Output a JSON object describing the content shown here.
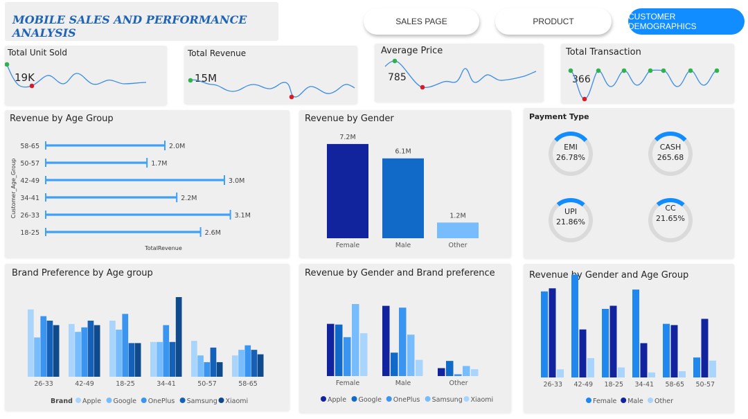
{
  "header": {
    "title": "MOBILE SALES AND PERFORMANCE ANALYSIS",
    "nav": [
      {
        "label": "SALES PAGE",
        "active": false
      },
      {
        "label": "PRODUCT",
        "active": false
      },
      {
        "label": "CUSTOMER DEMOGRAPHICS",
        "active": true
      }
    ]
  },
  "kpis": [
    {
      "title": "Total Unit Sold",
      "value": "19K"
    },
    {
      "title": "Total Revenue",
      "value": "15M"
    },
    {
      "title": "Average Price",
      "value": "785"
    },
    {
      "title": "Total Transaction",
      "value": "366"
    }
  ],
  "colors": {
    "accent": "#118dff",
    "line": "#3a8be6",
    "marker_high": "#2fb24c",
    "marker_low": "#d71c28",
    "navy": "#12239e",
    "mid_blue": "#1169c8",
    "light_blue": "#77bdfd"
  },
  "payment": {
    "title": "Payment Type",
    "items": [
      {
        "name": "EMI",
        "value": "26.78%",
        "fraction": 0.27
      },
      {
        "name": "CASH",
        "value": "265.68",
        "fraction": 0.26
      },
      {
        "name": "UPI",
        "value": "21.86%",
        "fraction": 0.22
      },
      {
        "name": "CC",
        "value": "21.65%",
        "fraction": 0.22
      }
    ]
  },
  "chart_data": [
    {
      "type": "bar",
      "orientation": "horizontal",
      "title": "Revenue by Age Group",
      "ylabel": "Customer_Age_Group",
      "xlabel": "TotalRevenue",
      "categories": [
        "58-65",
        "50-57",
        "42-49",
        "34-41",
        "26-33",
        "18-25"
      ],
      "values": [
        2.0,
        1.7,
        3.0,
        2.2,
        3.1,
        2.6
      ],
      "labels": [
        "2.0M",
        "1.7M",
        "3.0M",
        "2.2M",
        "3.1M",
        "2.6M"
      ]
    },
    {
      "type": "bar",
      "title": "Revenue by Gender",
      "categories": [
        "Female",
        "Male",
        "Other"
      ],
      "values": [
        7.2,
        6.1,
        1.2
      ],
      "labels": [
        "7.2M",
        "6.1M",
        "1.2M"
      ],
      "colors": [
        "#12239e",
        "#1169c8",
        "#77bdfd"
      ]
    },
    {
      "type": "bar",
      "title": "Brand Preference by Age group",
      "legend_title": "Brand",
      "categories": [
        "26-33",
        "42-49",
        "18-25",
        "34-41",
        "50-57",
        "58-65"
      ],
      "series": [
        {
          "name": "Apple",
          "color": "#a9d4fc",
          "values": [
            0.6,
            0.47,
            0.5,
            0.31,
            0.32,
            0.19
          ]
        },
        {
          "name": "Google",
          "color": "#77bdfd",
          "values": [
            0.35,
            0.4,
            0.42,
            0.31,
            0.19,
            0.24
          ]
        },
        {
          "name": "OnePlus",
          "color": "#3a95f0",
          "values": [
            0.54,
            0.44,
            0.56,
            0.46,
            0.13,
            0.28
          ]
        },
        {
          "name": "Samsung",
          "color": "#1561b8",
          "values": [
            0.5,
            0.5,
            0.3,
            0.31,
            0.26,
            0.24
          ]
        },
        {
          "name": "Xiaomi",
          "color": "#0f4a8c",
          "values": [
            0.46,
            0.46,
            0.3,
            0.71,
            0.13,
            0.2
          ]
        }
      ]
    },
    {
      "type": "bar",
      "title": "Revenue by Gender and Brand preference",
      "categories": [
        "Female",
        "Male",
        "Other"
      ],
      "series": [
        {
          "name": "Apple",
          "color": "#12239e",
          "values": [
            1.45,
            1.95,
            0.22
          ]
        },
        {
          "name": "Google",
          "color": "#1169c8",
          "values": [
            1.43,
            0.65,
            0.42
          ]
        },
        {
          "name": "OnePlus",
          "color": "#3a95f0",
          "values": [
            1.08,
            1.9,
            0.05
          ]
        },
        {
          "name": "Samsung",
          "color": "#77bdfd",
          "values": [
            2.0,
            1.15,
            0.28
          ]
        },
        {
          "name": "Xiaomi",
          "color": "#a9d4fc",
          "values": [
            1.19,
            0.45,
            0.19
          ]
        }
      ]
    },
    {
      "type": "bar",
      "title": "Revenue by Gender and Age Group",
      "categories": [
        "26-33",
        "42-49",
        "18-25",
        "34-41",
        "58-65",
        "50-57"
      ],
      "series": [
        {
          "name": "Female",
          "color": "#1e88f0",
          "values": [
            1.38,
            1.65,
            1.1,
            1.41,
            0.86,
            0.32
          ]
        },
        {
          "name": "Male",
          "color": "#12239e",
          "values": [
            1.43,
            0.77,
            1.15,
            0.55,
            0.84,
            0.94
          ]
        },
        {
          "name": "Other",
          "color": "#a9d4fc",
          "values": [
            0.13,
            0.31,
            0.16,
            0.08,
            0.1,
            0.27
          ]
        }
      ]
    }
  ]
}
